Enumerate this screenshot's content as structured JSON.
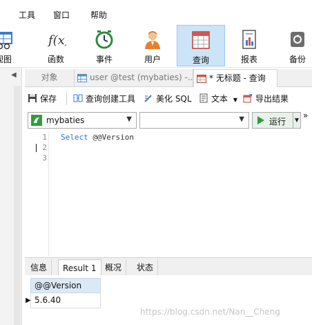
{
  "menu": {
    "items": [
      "工具",
      "窗口",
      "帮助"
    ]
  },
  "toolbar": {
    "items": [
      {
        "label": "视图",
        "icon": "view-icon"
      },
      {
        "label": "函数",
        "icon": "function-icon"
      },
      {
        "label": "事件",
        "icon": "event-clock-icon"
      },
      {
        "label": "用户",
        "icon": "user-icon"
      },
      {
        "label": "查询",
        "icon": "query-grid-icon",
        "active": true
      },
      {
        "label": "报表",
        "icon": "report-icon"
      },
      {
        "label": "备份",
        "icon": "backup-icon"
      }
    ]
  },
  "tabs": [
    {
      "label": "对象"
    },
    {
      "label": "user @test (mybaties) -..."
    },
    {
      "label": "* 无标题 - 查询",
      "active": true
    }
  ],
  "query_toolbar": {
    "save": "保存",
    "query_builder": "查询创建工具",
    "beautify": "美化 SQL",
    "text": "文本",
    "export": "导出结果"
  },
  "selectors": {
    "database": "mybaties",
    "schema": "",
    "run": "运行",
    "more": "»"
  },
  "editor": {
    "line_numbers": [
      "1",
      "2",
      "3"
    ],
    "keyword": "Select",
    "rest": " @@Version"
  },
  "results": {
    "tabs": [
      {
        "label": "信息"
      },
      {
        "label": "Result 1",
        "active": true
      },
      {
        "label": "概况"
      },
      {
        "label": "状态"
      }
    ],
    "column": "@@Version",
    "value": "5.6.40"
  },
  "watermark": "https://blog.csdn.net/Nan__Cheng",
  "colors": {
    "active_tool_bg": "#cce4f7",
    "keyword": "#2b6fcf",
    "run_icon": "#2e9e3a"
  }
}
